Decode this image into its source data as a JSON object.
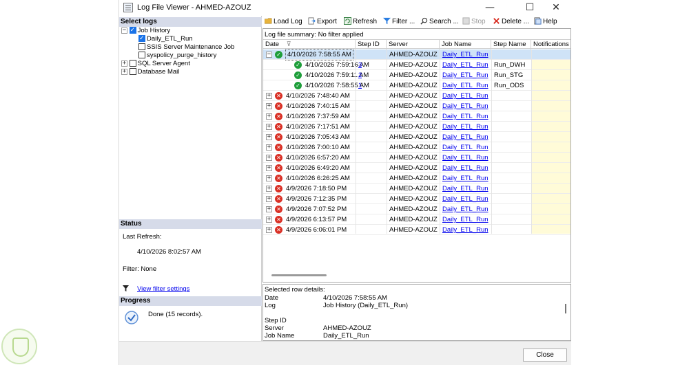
{
  "window": {
    "title": "Log File Viewer - AHMED-AZOUZ",
    "minimize": "—",
    "maximize": "☐",
    "close": "✕"
  },
  "select_logs": {
    "header": "Select logs",
    "items": [
      {
        "label": "Job History",
        "checked": true,
        "expanded": true
      },
      {
        "label": "Daily_ETL_Run",
        "checked": true
      },
      {
        "label": "SSIS Server Maintenance Job",
        "checked": false
      },
      {
        "label": "syspolicy_purge_history",
        "checked": false
      },
      {
        "label": "SQL Server Agent",
        "checked": false,
        "expanded": false
      },
      {
        "label": "Database Mail",
        "checked": false,
        "expanded": false
      }
    ]
  },
  "status": {
    "header": "Status",
    "last_refresh_label": "Last Refresh:",
    "last_refresh_value": "4/10/2026 8:02:57 AM",
    "filter": "Filter: None",
    "view_filter_link": "View filter settings"
  },
  "progress": {
    "header": "Progress",
    "text": "Done (15 records)."
  },
  "toolbar": {
    "load_log": "Load Log",
    "export": "Export",
    "refresh": "Refresh",
    "filter": "Filter ...",
    "search": "Search ...",
    "stop": "Stop",
    "delete": "Delete ...",
    "help": "Help"
  },
  "grid": {
    "summary": "Log file summary: No filter applied",
    "columns": [
      "Date",
      "Step ID",
      "Server",
      "Job Name",
      "Step Name",
      "Notifications"
    ],
    "rows": [
      {
        "status": "ok",
        "expander": "−",
        "date": "4/10/2026 7:58:55 AM",
        "step_id": "",
        "server": "AHMED-AZOUZ",
        "job": "Daily_ETL_Run",
        "step": "",
        "selected": true,
        "child": false
      },
      {
        "status": "ok",
        "expander": "",
        "date": "4/10/2026 7:59:16 AM",
        "step_id": "3",
        "server": "AHMED-AZOUZ",
        "job": "Daily_ETL_Run",
        "step": "Run_DWH",
        "child": true
      },
      {
        "status": "ok",
        "expander": "",
        "date": "4/10/2026 7:59:11 AM",
        "step_id": "2",
        "server": "AHMED-AZOUZ",
        "job": "Daily_ETL_Run",
        "step": "Run_STG",
        "child": true
      },
      {
        "status": "ok",
        "expander": "",
        "date": "4/10/2026 7:58:55 AM",
        "step_id": "1",
        "server": "AHMED-AZOUZ",
        "job": "Daily_ETL_Run",
        "step": "Run_ODS",
        "child": true
      },
      {
        "status": "err",
        "expander": "+",
        "date": "4/10/2026 7:48:40 AM",
        "step_id": "",
        "server": "AHMED-AZOUZ",
        "job": "Daily_ETL_Run",
        "step": ""
      },
      {
        "status": "err",
        "expander": "+",
        "date": "4/10/2026 7:40:15 AM",
        "step_id": "",
        "server": "AHMED-AZOUZ",
        "job": "Daily_ETL_Run",
        "step": ""
      },
      {
        "status": "err",
        "expander": "+",
        "date": "4/10/2026 7:37:59 AM",
        "step_id": "",
        "server": "AHMED-AZOUZ",
        "job": "Daily_ETL_Run",
        "step": ""
      },
      {
        "status": "err",
        "expander": "+",
        "date": "4/10/2026 7:17:51 AM",
        "step_id": "",
        "server": "AHMED-AZOUZ",
        "job": "Daily_ETL_Run",
        "step": ""
      },
      {
        "status": "err",
        "expander": "+",
        "date": "4/10/2026 7:05:43 AM",
        "step_id": "",
        "server": "AHMED-AZOUZ",
        "job": "Daily_ETL_Run",
        "step": ""
      },
      {
        "status": "err",
        "expander": "+",
        "date": "4/10/2026 7:00:10 AM",
        "step_id": "",
        "server": "AHMED-AZOUZ",
        "job": "Daily_ETL_Run",
        "step": ""
      },
      {
        "status": "err",
        "expander": "+",
        "date": "4/10/2026 6:57:20 AM",
        "step_id": "",
        "server": "AHMED-AZOUZ",
        "job": "Daily_ETL_Run",
        "step": ""
      },
      {
        "status": "err",
        "expander": "+",
        "date": "4/10/2026 6:49:20 AM",
        "step_id": "",
        "server": "AHMED-AZOUZ",
        "job": "Daily_ETL_Run",
        "step": ""
      },
      {
        "status": "err",
        "expander": "+",
        "date": "4/10/2026 6:26:25 AM",
        "step_id": "",
        "server": "AHMED-AZOUZ",
        "job": "Daily_ETL_Run",
        "step": ""
      },
      {
        "status": "err",
        "expander": "+",
        "date": "4/9/2026 7:18:50 PM",
        "step_id": "",
        "server": "AHMED-AZOUZ",
        "job": "Daily_ETL_Run",
        "step": ""
      },
      {
        "status": "err",
        "expander": "+",
        "date": "4/9/2026 7:12:35 PM",
        "step_id": "",
        "server": "AHMED-AZOUZ",
        "job": "Daily_ETL_Run",
        "step": ""
      },
      {
        "status": "err",
        "expander": "+",
        "date": "4/9/2026 7:07:52 PM",
        "step_id": "",
        "server": "AHMED-AZOUZ",
        "job": "Daily_ETL_Run",
        "step": ""
      },
      {
        "status": "err",
        "expander": "+",
        "date": "4/9/2026 6:13:57 PM",
        "step_id": "",
        "server": "AHMED-AZOUZ",
        "job": "Daily_ETL_Run",
        "step": ""
      },
      {
        "status": "err",
        "expander": "+",
        "date": "4/9/2026 6:06:01 PM",
        "step_id": "",
        "server": "AHMED-AZOUZ",
        "job": "Daily_ETL_Run",
        "step": ""
      }
    ]
  },
  "details": {
    "header": "Selected row details:",
    "fields": [
      {
        "label": "Date",
        "value": "4/10/2026 7:58:55 AM"
      },
      {
        "label": "Log",
        "value": "Job History (Daily_ETL_Run)"
      },
      {
        "label": "",
        "value": ""
      },
      {
        "label": "Step ID",
        "value": ""
      },
      {
        "label": "Server",
        "value": "AHMED-AZOUZ"
      },
      {
        "label": "Job Name",
        "value": "Daily_ETL_Run"
      }
    ]
  },
  "footer": {
    "close_label": "Close"
  },
  "colors": {
    "section_header": "#d6dbe9",
    "selected_row": "#cfe3f7",
    "notifications_column": "#fffbd8",
    "success": "#1e9e3a",
    "failure": "#d93025",
    "link": "#0000ee"
  }
}
